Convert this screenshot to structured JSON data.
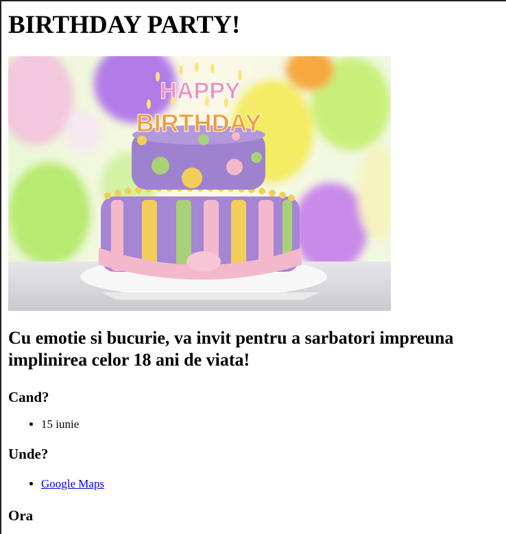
{
  "page": {
    "title": "BIRTHDAY PARTY!",
    "invitation": "Cu emotie si bucurie, va invit pentru a sarbatori impreuna implinirea celor 18 ani de viata!",
    "when": {
      "heading": "Cand?",
      "items": [
        "15 iunie"
      ]
    },
    "where": {
      "heading": "Unde?",
      "link_label": "Google Maps"
    },
    "time": {
      "heading": "Ora"
    },
    "image": {
      "alt": "birthday cake photo",
      "cake_text_top": "HAPPY",
      "cake_text_bottom": "BIRTHDAY"
    }
  },
  "colors": {
    "link": "#0000ee",
    "cake_purple": "#a585d4",
    "cake_pink": "#f4b8cc",
    "cake_yellow": "#f2cf5a",
    "cake_green": "#a9d178",
    "balloon_purple": "#b27be8",
    "balloon_yellow": "#f4ec63",
    "balloon_green": "#b8ea72"
  }
}
